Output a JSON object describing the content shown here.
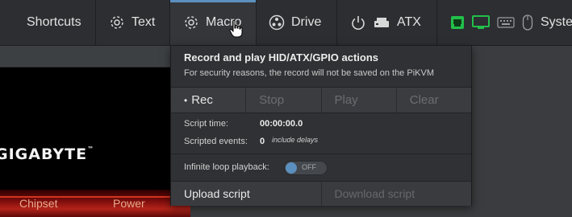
{
  "menu": {
    "shortcuts": "Shortcuts",
    "text": "Text",
    "macro": "Macro",
    "drive": "Drive",
    "atx": "ATX",
    "system": "Syste"
  },
  "icons": {
    "text": "gear-icon",
    "macro": "gear-icon",
    "drive": "drive-icon",
    "atx_power": "power-icon",
    "atx_box": "atx-box-icon",
    "status_network": "network-icon",
    "status_display": "monitor-icon",
    "status_keyboard": "keyboard-icon",
    "status_mouse": "mouse-icon"
  },
  "colors": {
    "accent": "#5b90bf",
    "status_ok": "#22c04a",
    "menubar_bg": "#2c2e31"
  },
  "stream": {
    "brand": "GIGABYTE",
    "labels": [
      "Chipset",
      "Power"
    ]
  },
  "macro": {
    "title": "Record and play HID/ATX/GPIO actions",
    "subtitle": "For security reasons, the record will not be saved on the PiKVM",
    "buttons": {
      "rec": "Rec",
      "stop": "Stop",
      "play": "Play",
      "clear": "Clear"
    },
    "script_time_label": "Script time:",
    "script_time_value": "00:00:00.0",
    "scripted_events_label": "Scripted events:",
    "scripted_events_value": "0",
    "scripted_events_note": "include delays",
    "loop_label": "Infinite loop playback:",
    "loop_state": "OFF",
    "upload": "Upload script",
    "download": "Download script"
  }
}
